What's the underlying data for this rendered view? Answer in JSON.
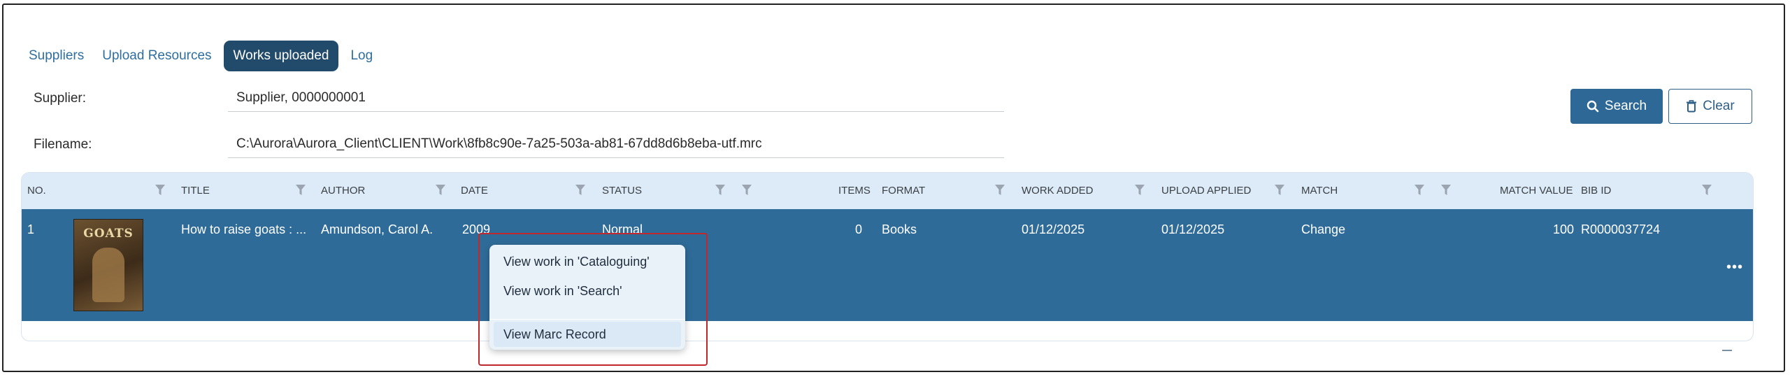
{
  "tabs": [
    {
      "label": "Suppliers",
      "active": false
    },
    {
      "label": "Upload Resources",
      "active": false
    },
    {
      "label": "Works uploaded",
      "active": true
    },
    {
      "label": "Log",
      "active": false
    }
  ],
  "form": {
    "supplier_label": "Supplier:",
    "supplier_value": "Supplier, 0000000001",
    "filename_label": "Filename:",
    "filename_value": "C:\\Aurora\\Aurora_Client\\CLIENT\\Work\\8fb8c90e-7a25-503a-ab81-67dd8d6b8eba-utf.mrc"
  },
  "buttons": {
    "search_label": "Search",
    "clear_label": "Clear"
  },
  "table": {
    "columns": [
      "NO.",
      "TITLE",
      "AUTHOR",
      "DATE",
      "STATUS",
      "ITEMS",
      "FORMAT",
      "WORK ADDED",
      "UPLOAD APPLIED",
      "MATCH",
      "MATCH VALUE",
      "BIB ID"
    ],
    "rows": [
      {
        "no": "1",
        "cover_text": "GOATS",
        "title": "How to raise goats : ...",
        "author": "Amundson, Carol A.",
        "date": "2009",
        "status": "Normal",
        "items": "0",
        "format": "Books",
        "work_added": "01/12/2025",
        "upload_applied": "01/12/2025",
        "match": "Change",
        "match_value": "100",
        "bib_id": "R0000037724",
        "more": "•••"
      }
    ]
  },
  "context_menu": {
    "items": [
      "View work in 'Cataloguing'",
      "View work in 'Search'",
      "View Marc Record"
    ]
  },
  "colors": {
    "accent": "#2e6896",
    "active_tab": "#224a6b",
    "selected_row": "#2f6b98",
    "header_bg": "#dcebf7",
    "annotation": "#c0282d"
  },
  "icons": [
    "filter-icon",
    "search-icon",
    "trash-icon",
    "more-icon"
  ]
}
